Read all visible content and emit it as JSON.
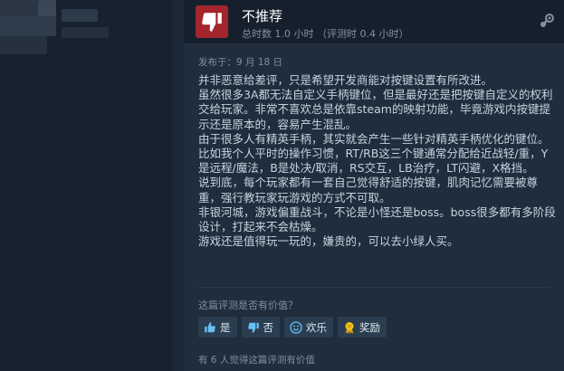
{
  "review": {
    "verdict": "不推荐",
    "playtime": "总时数 1.0 小时 （评测时 0.4 小时）",
    "posted": "发布于：9 月 18 日",
    "paragraphs": [
      "并非恶意给差评，只是希望开发商能对按键设置有所改进。",
      "虽然很多3A都无法自定义手柄键位，但是最好还是把按键自定义的权利交给玩家。非常不喜欢总是依靠steam的映射功能，毕竟游戏内按键提示还是原本的，容易产生混乱。",
      "由于很多人有精英手柄，其实就会产生一些针对精英手柄优化的键位。比如我个人平时的操作习惯，RT/RB这三个键通常分配给近战轻/重，Y是远程/魔法，B是处决/取消，RS交互，LB治疗，LT闪避，X格挡。",
      "说到底，每个玩家都有一套自己觉得舒适的按键，肌肉记忆需要被尊重，强行教玩家玩游戏的方式不可取。",
      "非银河城，游戏偏重战斗，不论是小怪还是boss。boss很多都有多阶段设计，打起来不会枯燥。",
      "游戏还是值得玩一玩的，嫌贵的，可以去小绿人买。"
    ],
    "helpful_question": "这篇评测是否有价值？",
    "votes": {
      "yes": "是",
      "no": "否",
      "funny": "欢乐",
      "award": "奖励"
    },
    "helpful_count": "有 6 人觉得这篇评测有价值"
  },
  "icons": {
    "verdict": "thumbs-down-icon",
    "corner": "steam-logo-icon",
    "yes": "thumbs-up-icon",
    "no": "thumbs-down-icon",
    "funny": "smiley-icon",
    "award": "award-icon"
  },
  "colors": {
    "background": "#1b2838",
    "panel": "#1f2d3d",
    "header": "#16202d",
    "not_recommended": "#a3262c",
    "text": "#c6d4df",
    "muted": "#7f8fa2",
    "award": "#f5c518"
  }
}
